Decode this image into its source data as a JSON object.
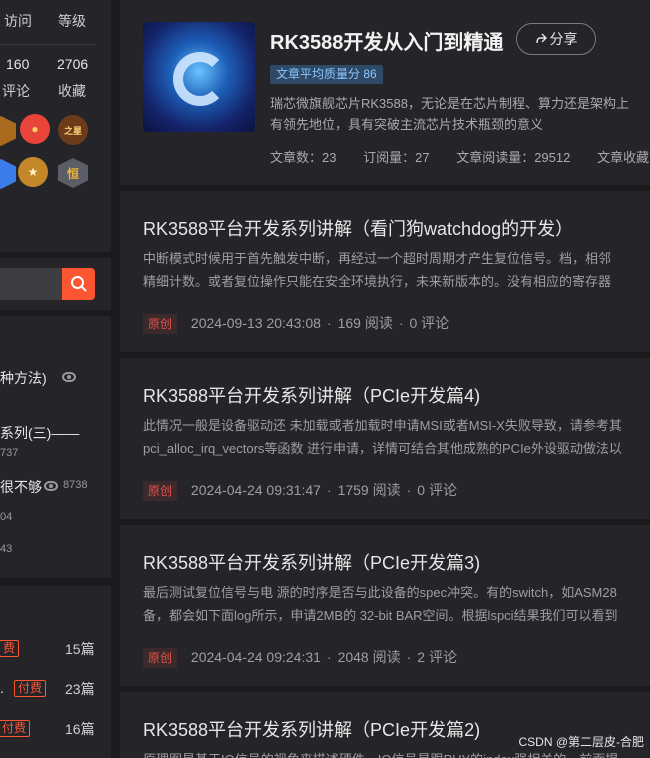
{
  "sidebar": {
    "stats": {
      "headers": [
        "访问",
        "等级"
      ],
      "values": [
        "160",
        "2706"
      ],
      "labels": [
        "评论",
        "收藏"
      ]
    },
    "hot_articles": [
      {
        "title": "种方法)",
        "views": ""
      },
      {
        "title": "系列(三)——",
        "views": "737"
      },
      {
        "title": "很不够",
        "views": "8738"
      },
      {
        "title": "",
        "views": "04"
      },
      {
        "title": "",
        "views": "43"
      }
    ],
    "columns": [
      {
        "tag": "费",
        "count": "15篇"
      },
      {
        "tag": "付费",
        "count": "23篇"
      },
      {
        "tag": "付费",
        "count": "16篇"
      }
    ]
  },
  "column": {
    "title": "RK3588开发从入门到精通",
    "share_label": "分享",
    "quality_label": "文章平均质量分 86",
    "desc_line1": "瑞芯微旗舰芯片RK3588，无论是在芯片制程、算力还是架构上",
    "desc_line2": "有领先地位，具有突破主流芯片技术瓶颈的意义",
    "stat_articles": "文章数：23",
    "stat_subscribers": "订阅量：27",
    "stat_reads": "文章阅读量：29512",
    "stat_favs": "文章收藏"
  },
  "articles": [
    {
      "title": "RK3588平台开发系列讲解（看门狗watchdog的开发）",
      "desc_line1": "中断模式时候用于首先触发中断，再经过一个超时周期才产生复位信号。档，相邻",
      "desc_line2": "精细计数。或者复位操作只能在安全环境执行，未来新版本的。没有相应的寄存器",
      "tag": "原创",
      "date": "2024-09-13 20:43:08",
      "reads": "169 阅读",
      "comments": "0 评论"
    },
    {
      "title": "RK3588平台开发系列讲解（PCIe开发篇4)",
      "desc_line1": "此情况一般是设备驱动还 未加载或者加载时申请MSI或者MSI-X失败导致，请参考其",
      "desc_line2": "pci_alloc_irq_vectors等函数 进行申请，详情可结合其他成熟的PCIe外设驱动做法以",
      "tag": "原创",
      "date": "2024-04-24 09:31:47",
      "reads": "1759 阅读",
      "comments": "0 评论"
    },
    {
      "title": "RK3588平台开发系列讲解（PCIe开发篇3)",
      "desc_line1": "最后测试复位信号与电 源的时序是否与此设备的spec冲突。有的switch，如ASM28",
      "desc_line2": "备，都会如下面log所示，申请2MB的 32-bit BAR空间。根据lspci结果我们可以看到",
      "tag": "原创",
      "date": "2024-04-24 09:24:31",
      "reads": "2048 阅读",
      "comments": "2 评论"
    },
    {
      "title": "RK3588平台开发系列讲解（PCIe开发篇2)",
      "desc_line1": "原理图是基于IO信号的视角来描述硬件，IO信号是跟PHY的index强相关的。前面提",
      "desc_line2": "",
      "tag": "原创",
      "date": "",
      "reads": "",
      "comments": ""
    }
  ],
  "watermark": "CSDN @第二层皮-合肥",
  "colors": {
    "accent": "#fc5531",
    "original_tag": "#e3534a",
    "quality_bg": "#2e4a66",
    "quality_text": "#8cc6ff"
  }
}
